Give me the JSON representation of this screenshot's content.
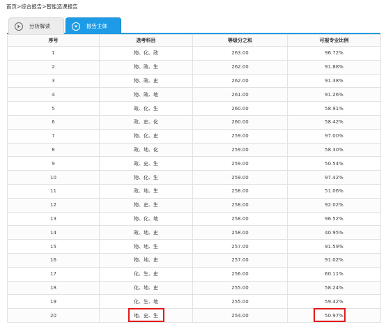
{
  "breadcrumb": [
    "首页",
    "综合报告",
    "智能选课报告"
  ],
  "breadcrumb_sep": ">",
  "tabs": [
    {
      "label": "分析解读",
      "icon": "play-circle-icon",
      "active": false
    },
    {
      "label": "报告主体",
      "icon": "chevron-down-circle-icon",
      "active": true
    }
  ],
  "table": {
    "columns": [
      "序号",
      "选考科目",
      "等级分之和",
      "可报专业比例"
    ],
    "rows": [
      [
        "1",
        "物、化、政",
        "263.00",
        "96.72%"
      ],
      [
        "2",
        "物、政、生",
        "262.00",
        "91.88%"
      ],
      [
        "3",
        "物、政、史",
        "262.00",
        "91.38%"
      ],
      [
        "4",
        "物、政、地",
        "261.00",
        "91.26%"
      ],
      [
        "5",
        "政、化、生",
        "260.00",
        "58.91%"
      ],
      [
        "6",
        "政、史、化",
        "260.00",
        "58.42%"
      ],
      [
        "7",
        "物、化、史",
        "259.00",
        "97.00%"
      ],
      [
        "8",
        "政、地、化",
        "259.00",
        "58.30%"
      ],
      [
        "9",
        "政、史、生",
        "259.00",
        "50.54%"
      ],
      [
        "10",
        "物、化、生",
        "259.00",
        "97.42%"
      ],
      [
        "11",
        "政、地、生",
        "258.00",
        "51.06%"
      ],
      [
        "12",
        "物、史、生",
        "258.00",
        "92.02%"
      ],
      [
        "13",
        "物、化、地",
        "258.00",
        "96.52%"
      ],
      [
        "14",
        "政、地、史",
        "258.00",
        "40.95%"
      ],
      [
        "15",
        "物、地、生",
        "257.00",
        "91.59%"
      ],
      [
        "16",
        "物、地、史",
        "257.00",
        "91.02%"
      ],
      [
        "17",
        "化、生、史",
        "256.00",
        "60.11%"
      ],
      [
        "18",
        "化、地、史",
        "255.00",
        "58.24%"
      ],
      [
        "19",
        "化、生、地",
        "255.00",
        "59.42%"
      ],
      [
        "20",
        "地、史、生",
        "254.00",
        "50.97%"
      ]
    ]
  },
  "highlight_color": "#e01b1b",
  "accent_color": "#1e9be6"
}
